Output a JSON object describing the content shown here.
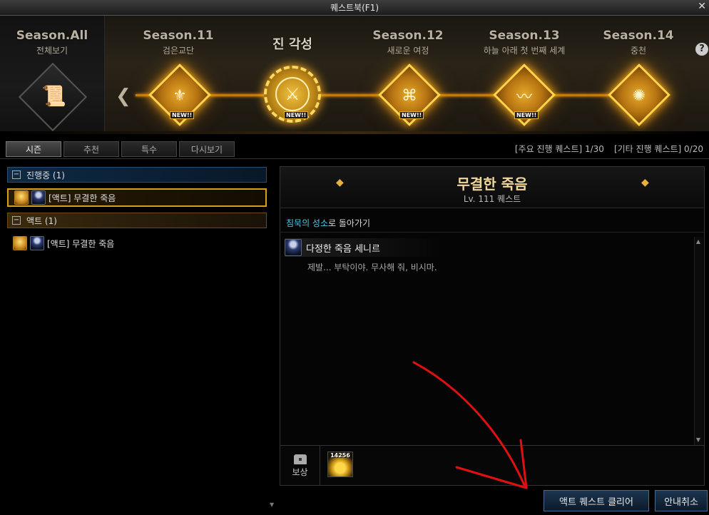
{
  "window": {
    "title": "퀘스트북(F1)",
    "close_glyph": "✕"
  },
  "seasons": {
    "all": {
      "name": "Season.All",
      "sub": "전체보기"
    },
    "awakening": {
      "name": "진 각성"
    },
    "s11": {
      "name": "Season.11",
      "sub": "검은교단",
      "badge": "NEW!!"
    },
    "s12": {
      "name": "Season.12",
      "sub": "새로운 여정",
      "badge": "NEW!!"
    },
    "s13": {
      "name": "Season.13",
      "sub": "하늘 아래 첫 번째 세계",
      "badge": "NEW!!"
    },
    "s14": {
      "name": "Season.14",
      "sub": "중천"
    },
    "awakening_badge": "NEW!!",
    "help_glyph": "?"
  },
  "tabs": [
    "시즌",
    "추천",
    "특수",
    "다시보기"
  ],
  "counts": {
    "main": "[주요 진행 퀘스트] 1/30",
    "other": "[기타 진행 퀘스트] 0/20"
  },
  "quest_list": {
    "group_in_progress": {
      "label": "진행중 (1)"
    },
    "in_progress_items": [
      {
        "label": "[액트] 무결한 죽음"
      }
    ],
    "group_act": {
      "label": "액트 (1)"
    },
    "act_items": [
      {
        "label": "[액트] 무결한 죽음"
      }
    ]
  },
  "detail": {
    "title": "무결한 죽음",
    "level": "Lv. 111 퀘스트",
    "goto": {
      "part1": "침묵의 성소",
      "part2": "로 돌아가기"
    },
    "npc_name": "다정한 죽음 세니르",
    "npc_line": "제발... 부탁이야. 무사해 줘, 비시마.",
    "reward_label": "보상",
    "reward_count": "14256"
  },
  "buttons": {
    "clear": "액트 퀘스트 클리어",
    "cancel": "안내취소"
  },
  "colors": {
    "accent_gold": "#f2d79a",
    "link_cyan": "#4fc6e6",
    "annotation_red": "#e01010"
  }
}
